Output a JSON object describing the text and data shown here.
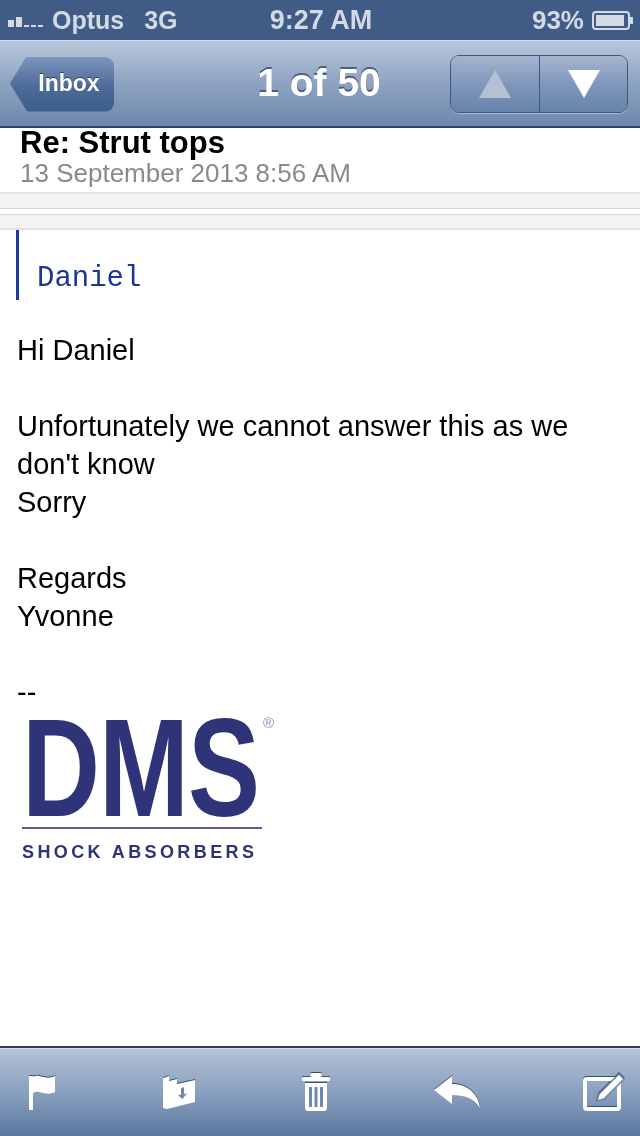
{
  "status_bar": {
    "carrier": "Optus",
    "network": "3G",
    "time": "9:27 AM",
    "battery": "93%"
  },
  "nav_bar": {
    "back_button": "Inbox",
    "title": "1 of 50",
    "arrows": [
      {
        "kind": "up",
        "disabled": true
      },
      {
        "kind": "down",
        "disabled": false
      }
    ]
  },
  "message": {
    "subject": "Re: Strut tops",
    "date": "13 September 2013 8:56 AM",
    "quote": "Daniel",
    "paragraphs": [
      [
        "Hi Daniel"
      ],
      [
        "Unfortunately we cannot answer this as we don't know",
        "Sorry"
      ],
      [
        "Regards",
        "Yvonne"
      ],
      [
        "--"
      ]
    ],
    "logo": {
      "wordmark": "DMS",
      "registered": "®",
      "tagline": "SHOCK ABSORBERS"
    }
  },
  "toolbar": [
    {
      "kind": "flag"
    },
    {
      "kind": "move"
    },
    {
      "kind": "trash"
    },
    {
      "kind": "reply"
    },
    {
      "kind": "compose"
    }
  ]
}
